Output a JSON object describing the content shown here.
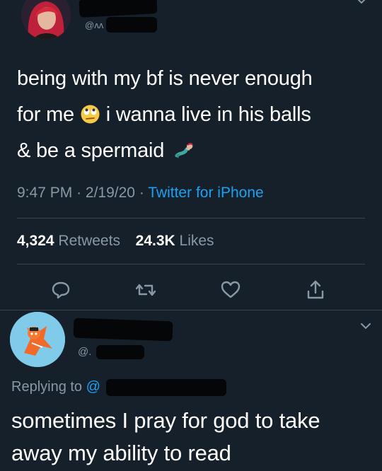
{
  "tweet": {
    "handle_prefix": "@ʌʌ",
    "body_line1": "being with my bf is never enough",
    "body_line2a": "for me",
    "body_line2b": " i wanna live in his balls",
    "body_line3": "& be a spermaid",
    "emoji_1": "rolling-eyes-emoji",
    "emoji_2": "mermaid-emoji",
    "time": "9:47 PM",
    "date": "2/19/20",
    "source": "Twitter for iPhone",
    "retweets_count": "4,324",
    "retweets_label": "Retweets",
    "likes_count": "24.3K",
    "likes_label": "Likes",
    "actions": [
      "reply-icon",
      "retweet-icon",
      "like-icon",
      "share-icon"
    ]
  },
  "reply": {
    "handle_prefix": "@.",
    "replying_label": "Replying to",
    "replying_at": "@",
    "body": "sometimes I pray for god to take away my ability to read"
  },
  "colors": {
    "background": "#15202b",
    "secondary_text": "#8899a6",
    "accent": "#1da1f2",
    "divider": "#38444d"
  }
}
